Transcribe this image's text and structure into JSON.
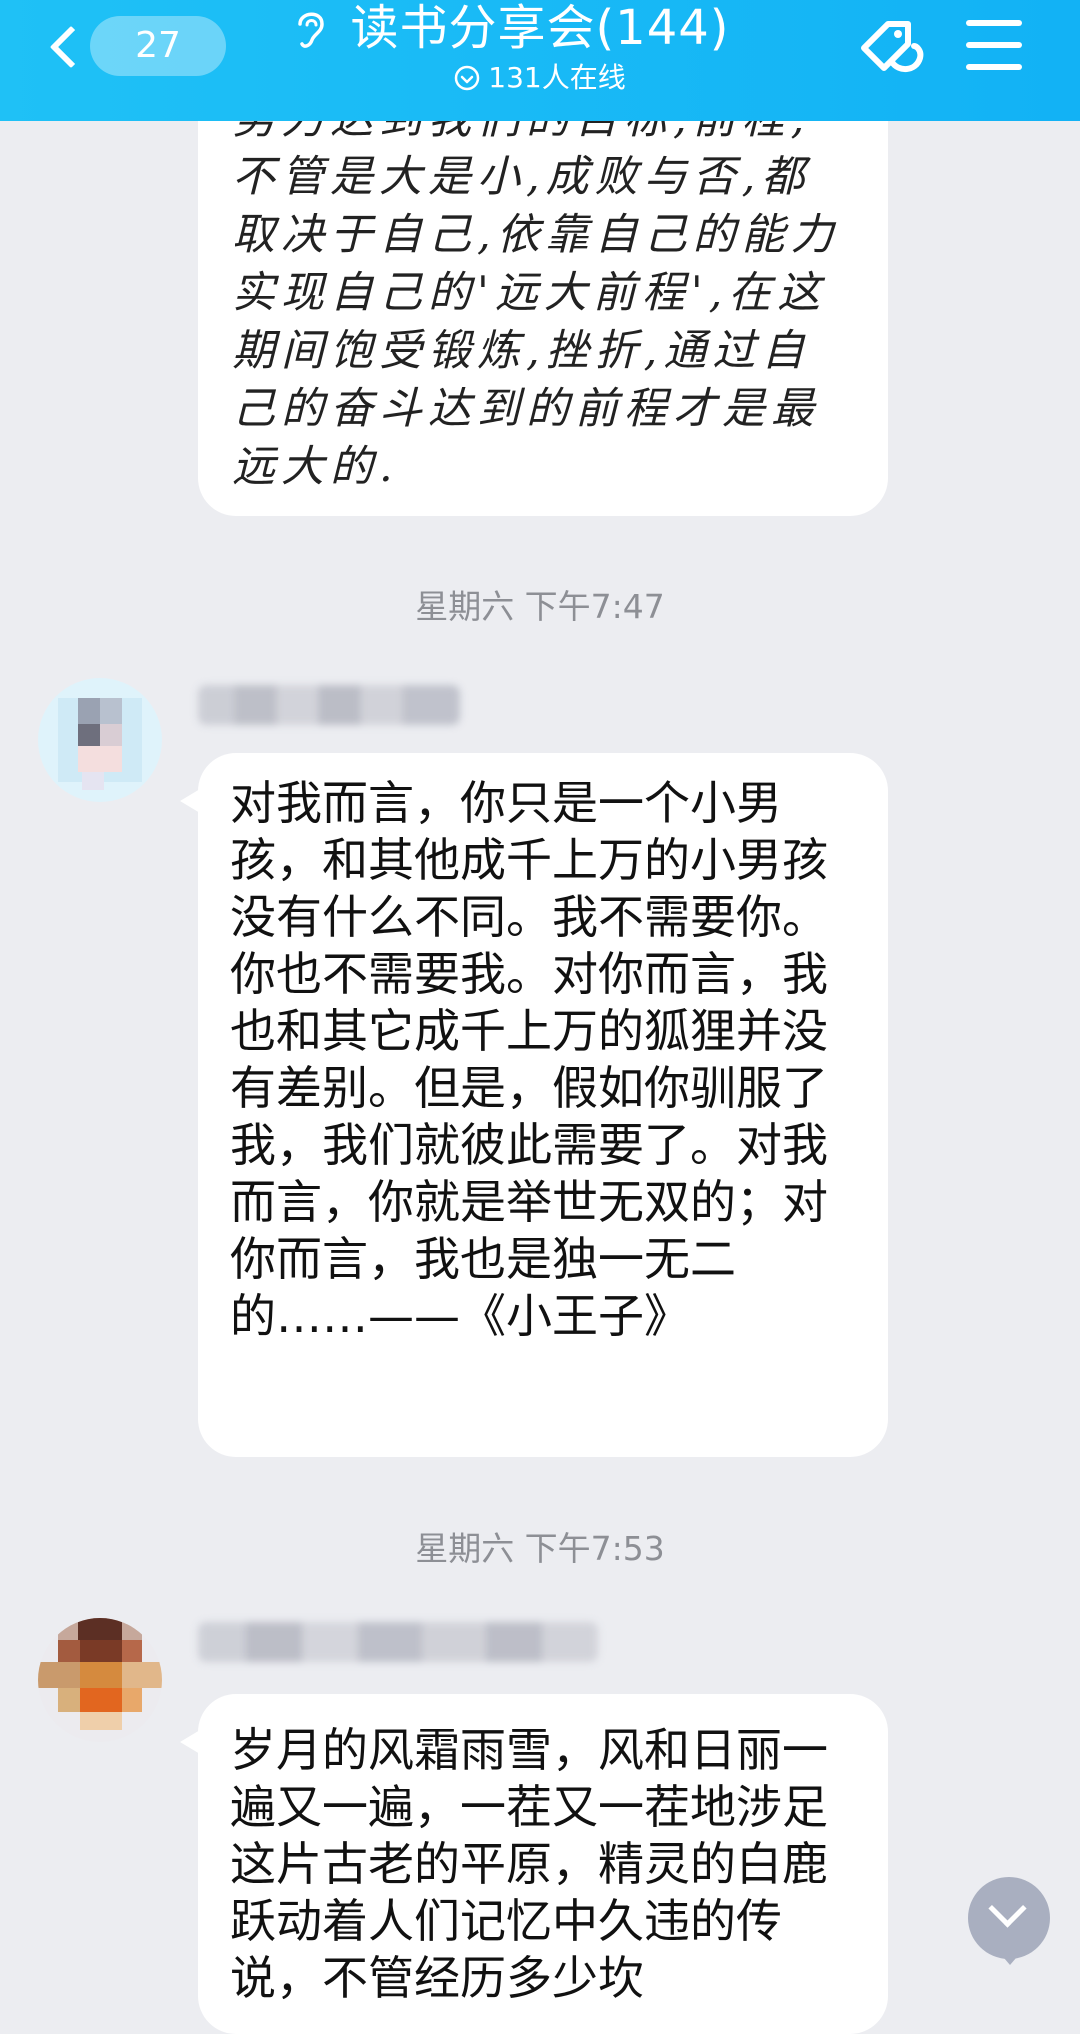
{
  "header": {
    "back_count": "27",
    "title": "读书分享会(144)",
    "online": "131人在线",
    "icons": [
      "back-chevron-icon",
      "ear-icon",
      "online-check-icon",
      "tag-icon",
      "menu-icon"
    ]
  },
  "messages": [
    {
      "text": "努力达到我们的目标,前程,不管是大是小,成败与否,都取决于自己,依靠自己的能力实现自己的'远大前程',在这期间饱受锻炼,挫折,通过自己的奋斗达到的前程才是最远大的."
    },
    {
      "timestamp": "星期六 下午7:47",
      "text": "对我而言，你只是一个小男孩，和其他成千上万的小男孩没有什么不同。我不需要你。你也不需要我。对你而言，我也和其它成千上万的狐狸并没有差别。但是，假如你驯服了我，我们就彼此需要了。对我而言，你就是举世无双的；对你而言，我也是独一无二的……——《小王子》"
    },
    {
      "timestamp": "星期六 下午7:53",
      "text": "岁月的风霜雨雪，风和日丽一遍又一遍，一茬又一茬地涉足这片古老的平原，精灵的白鹿跃动着人们记忆中久违的传说，不管经历多少坎"
    }
  ],
  "colors": {
    "header": "#14b6f5",
    "background": "#ecedf1",
    "bubble": "#ffffff",
    "timestamp": "#8d8f95",
    "scroll_button": "#a9afc0"
  }
}
